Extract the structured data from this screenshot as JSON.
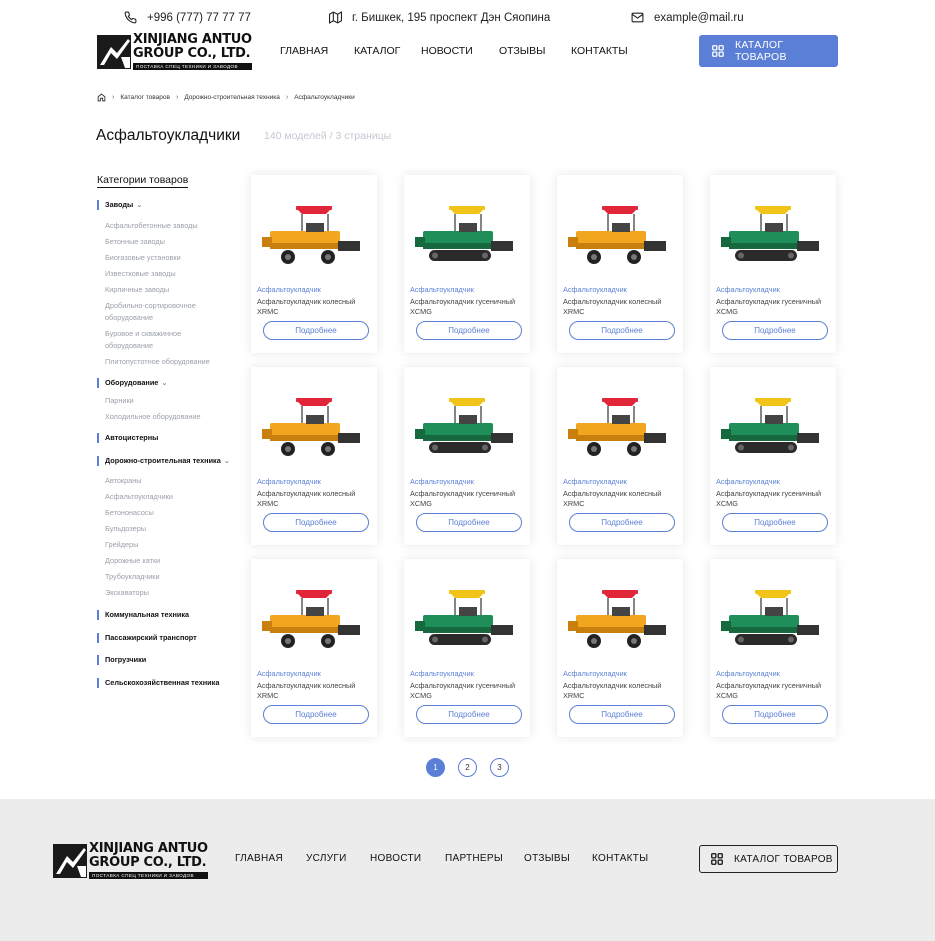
{
  "topbar": {
    "phone": "+996 (777) 77 77 77",
    "address": "г. Бишкек, 195 проспект Дэн Сяопина",
    "email": "example@mail.ru"
  },
  "logo": {
    "line1": "XINJIANG ANTUO",
    "line2": "GROUP CO., LTD.",
    "tagline": "ПОСТАВКА СПЕЦ ТЕХНИКИ И ЗАВОДОВ"
  },
  "nav": [
    "ГЛАВНАЯ",
    "КАТАЛОГ",
    "НОВОСТИ",
    "ОТЗЫВЫ",
    "КОНТАКТЫ"
  ],
  "catalog_button": "КАТАЛОГ ТОВАРОВ",
  "breadcrumb": [
    "Каталог товаров",
    "Дорожно-строительная техника",
    "Асфальтоукладчики"
  ],
  "page_title": "Асфальтоукладчики",
  "page_subtitle": "140 моделей / 3 страницы",
  "sidebar": {
    "title": "Категории товаров",
    "groups": [
      {
        "label": "Заводы",
        "expanded": true,
        "items": [
          "Асфальтобетонные заводы",
          "Бетонные заводы",
          "Биогазовые установки",
          "Известковые заводы",
          "Кирпичные заводы",
          "Дробильно-сортировочное оборудование",
          "Буровое и скважинное оборудование",
          "Плитопустотное оборудование"
        ]
      },
      {
        "label": "Оборудование",
        "expanded": true,
        "items": [
          "Парники",
          "Холодильное оборудование"
        ]
      },
      {
        "label": "Автоцистерны",
        "expanded": false,
        "items": []
      },
      {
        "label": "Дорожно-строительная техника",
        "expanded": true,
        "items": [
          "Автокраны",
          "Асфальтоукладчики",
          "Бетононасосы",
          "Бульдозеры",
          "Грейдеры",
          "Дорожные катки",
          "Трубоукладчики",
          "Экскаваторы"
        ]
      },
      {
        "label": "Коммунальная техника",
        "expanded": false,
        "items": []
      },
      {
        "label": "Пассажирский транспорт",
        "expanded": false,
        "items": []
      },
      {
        "label": "Погрузчики",
        "expanded": false,
        "items": []
      },
      {
        "label": "Сельскохозяйственная техника",
        "expanded": false,
        "items": []
      }
    ]
  },
  "products": [
    {
      "category": "Асфальтоукладчик",
      "name": "Асфальтоукладчик колесный XRMC",
      "variant": "wheeled",
      "button": "Подробнее"
    },
    {
      "category": "Асфальтоукладчик",
      "name": "Асфальтоукладчик гусеничный XCMG",
      "variant": "tracked",
      "button": "Подробнее"
    },
    {
      "category": "Асфальтоукладчик",
      "name": "Асфальтоукладчик колесный XRMC",
      "variant": "wheeled",
      "button": "Подробнее"
    },
    {
      "category": "Асфальтоукладчик",
      "name": "Асфальтоукладчик гусеничный XCMG",
      "variant": "tracked",
      "button": "Подробнее"
    },
    {
      "category": "Асфальтоукладчик",
      "name": "Асфальтоукладчик колесный XRMC",
      "variant": "wheeled",
      "button": "Подробнее"
    },
    {
      "category": "Асфальтоукладчик",
      "name": "Асфальтоукладчик гусеничный XCMG",
      "variant": "tracked",
      "button": "Подробнее"
    },
    {
      "category": "Асфальтоукладчик",
      "name": "Асфальтоукладчик колесный XRMC",
      "variant": "wheeled",
      "button": "Подробнее"
    },
    {
      "category": "Асфальтоукладчик",
      "name": "Асфальтоукладчик гусеничный XCMG",
      "variant": "tracked",
      "button": "Подробнее"
    },
    {
      "category": "Асфальтоукладчик",
      "name": "Асфальтоукладчик колесный XRMC",
      "variant": "wheeled",
      "button": "Подробнее"
    },
    {
      "category": "Асфальтоукладчик",
      "name": "Асфальтоукладчик гусеничный XCMG",
      "variant": "tracked",
      "button": "Подробнее"
    },
    {
      "category": "Асфальтоукладчик",
      "name": "Асфальтоукладчик колесный XRMC",
      "variant": "wheeled",
      "button": "Подробнее"
    },
    {
      "category": "Асфальтоукладчик",
      "name": "Асфальтоукладчик гусеничный XCMG",
      "variant": "tracked",
      "button": "Подробнее"
    }
  ],
  "pagination": {
    "pages": [
      "1",
      "2",
      "3"
    ],
    "current": "1"
  },
  "footer": {
    "nav": [
      "ГЛАВНАЯ",
      "УСЛУГИ",
      "НОВОСТИ",
      "ПАРТНЕРЫ",
      "ОТЗЫВЫ",
      "КОНТАКТЫ"
    ],
    "catalog_button": "КАТАЛОГ ТОВАРОВ"
  },
  "colors": {
    "accent": "#5b7fd6",
    "footer_bg": "#ececec",
    "muted_text": "#9aa0aa"
  },
  "icons": [
    "phone-icon",
    "map-icon",
    "mail-icon",
    "grid-icon",
    "home-icon",
    "chevron-right-icon",
    "chevron-down-icon"
  ]
}
